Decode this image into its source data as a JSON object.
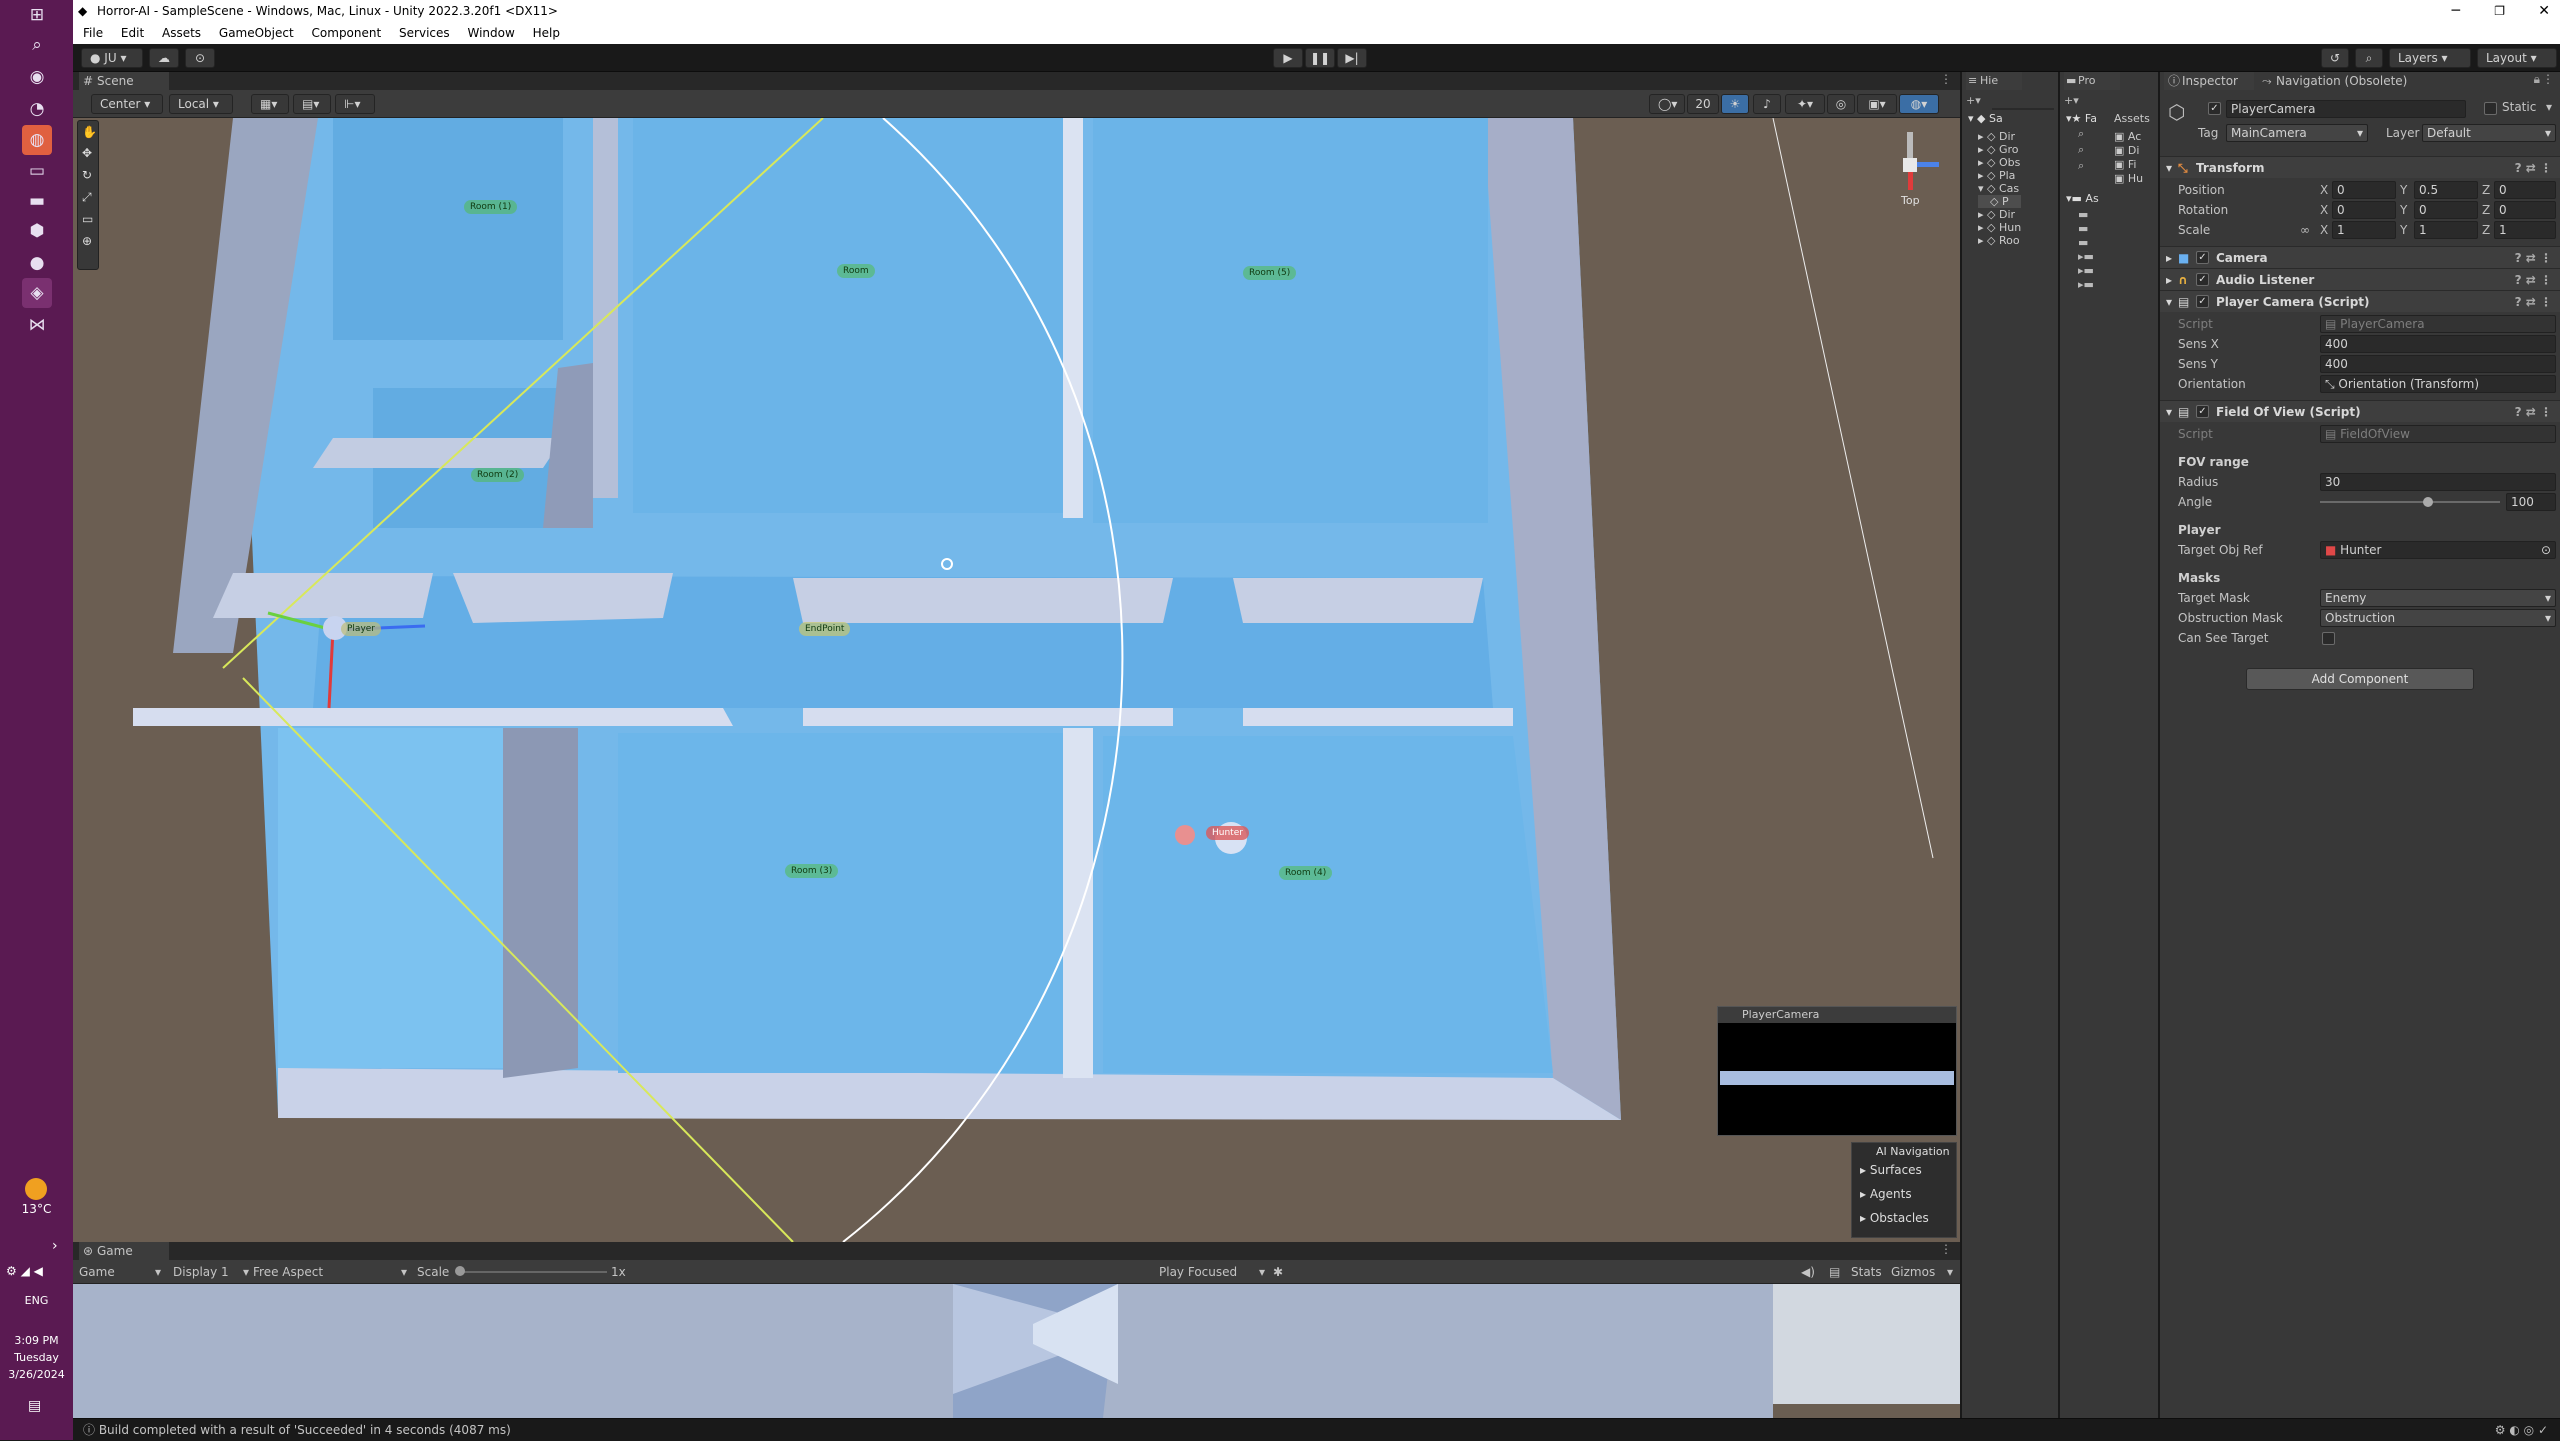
{
  "titlebar": {
    "title": "Horror-AI - SampleScene - Windows, Mac, Linux - Unity 2022.3.20f1 <DX11>"
  },
  "menu": [
    "File",
    "Edit",
    "Assets",
    "GameObject",
    "Component",
    "Services",
    "Window",
    "Help"
  ],
  "toolbar": {
    "account": "JU",
    "layers": "Layers",
    "layout": "Layout"
  },
  "scene": {
    "tab": "Scene",
    "pivot": "Center",
    "space": "Local",
    "grid_size": "20",
    "labels": [
      "Room (1)",
      "Room",
      "Room (5)",
      "Room (2)",
      "Player",
      "EndPoint",
      "Hunter",
      "Room (3)",
      "Room (4)"
    ],
    "gizmo_label": "Top",
    "camera_preview_title": "PlayerCamera",
    "ai_nav": {
      "title": "AI Navigation",
      "items": [
        "Surfaces",
        "Agents",
        "Obstacles"
      ]
    }
  },
  "game": {
    "tab": "Game",
    "mode": "Game",
    "display": "Display 1",
    "aspect": "Free Aspect",
    "scale_label": "Scale",
    "scale_value": "1x",
    "play_focus": "Play Focused",
    "stats": "Stats",
    "gizmos": "Gizmos"
  },
  "hierarchy": {
    "tab": "Hie",
    "items": [
      "Sa",
      "Dir",
      "Gro",
      "Obs",
      "Pla",
      "Cas",
      "P",
      "Dir",
      "Hun",
      "Roo"
    ]
  },
  "project": {
    "tab": "Pro",
    "favorites": "Fa",
    "assets": "As",
    "breadcrumb": "Assets",
    "items": [
      "Ac",
      "Di",
      "Fi",
      "Hu"
    ]
  },
  "inspector": {
    "tab": "Inspector",
    "tab2": "Navigation (Obsolete)",
    "object_name": "PlayerCamera",
    "static_label": "Static",
    "tag_label": "Tag",
    "tag": "MainCamera",
    "layer_label": "Layer",
    "layer": "Default",
    "transform": {
      "title": "Transform",
      "position": {
        "label": "Position",
        "x": "0",
        "y": "0.5",
        "z": "0"
      },
      "rotation": {
        "label": "Rotation",
        "x": "0",
        "y": "0",
        "z": "0"
      },
      "scale": {
        "label": "Scale",
        "x": "1",
        "y": "1",
        "z": "1"
      }
    },
    "camera": "Camera",
    "audio": "Audio Listener",
    "player_camera": {
      "title": "Player Camera (Script)",
      "script_label": "Script",
      "script": "PlayerCamera",
      "sensx_label": "Sens X",
      "sensx": "400",
      "sensy_label": "Sens Y",
      "sensy": "400",
      "orientation_label": "Orientation",
      "orientation": "Orientation (Transform)"
    },
    "fov": {
      "title": "Field Of View (Script)",
      "script_label": "Script",
      "script": "FieldOfView",
      "section": "FOV range",
      "radius_label": "Radius",
      "radius": "30",
      "angle_label": "Angle",
      "angle": "100",
      "angle_fraction": 0.6,
      "player_section": "Player",
      "target_label": "Target Obj Ref",
      "target": "Hunter",
      "masks_section": "Masks",
      "target_mask_label": "Target Mask",
      "target_mask": "Enemy",
      "obstruction_label": "Obstruction Mask",
      "obstruction": "Obstruction",
      "can_see_label": "Can See Target"
    },
    "add_component": "Add Component"
  },
  "status": {
    "message": "Build completed with a result of 'Succeeded' in 4 seconds (4087 ms)"
  },
  "taskbar": {
    "temp": "13°C",
    "lang": "ENG",
    "time": "3:09 PM",
    "day": "Tuesday",
    "date": "3/26/2024"
  }
}
